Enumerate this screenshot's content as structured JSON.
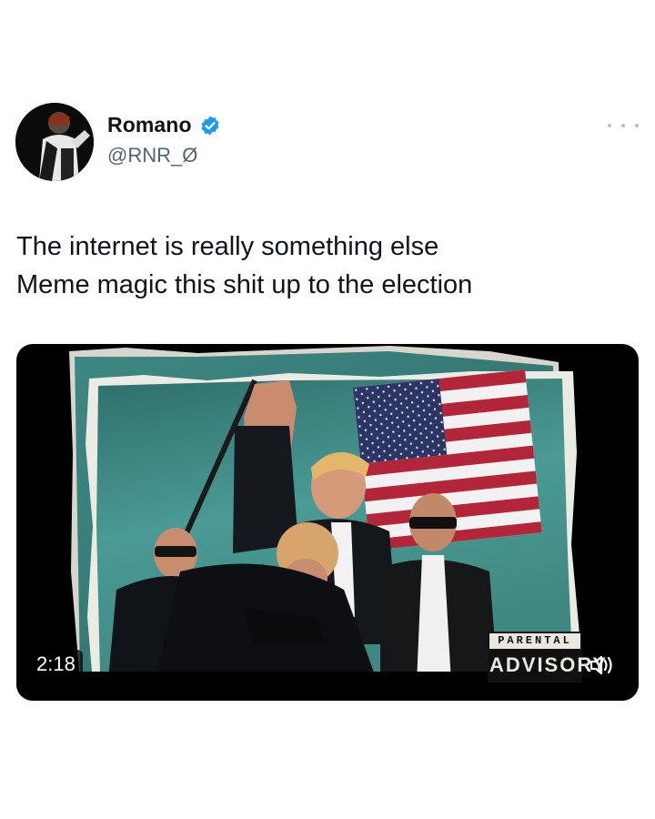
{
  "user": {
    "display_name": "Romano",
    "handle": "@RNR_Ø",
    "verified": true,
    "avatar_icon": "avatar-silhouette"
  },
  "tweet": {
    "lines": [
      "The internet is really something else",
      "Meme magic this shit up to the election"
    ]
  },
  "video": {
    "duration": "2:18",
    "advisory_top": "PARENTAL",
    "advisory_bottom": "ADVISORY",
    "sound_icon": "speaker-icon"
  },
  "icons": {
    "more": "more-options-icon",
    "verified": "verified-badge-icon"
  },
  "colors": {
    "verified_blue": "#1d9bf0",
    "handle_gray": "#536471",
    "sky_teal": "#3f8f8c"
  }
}
